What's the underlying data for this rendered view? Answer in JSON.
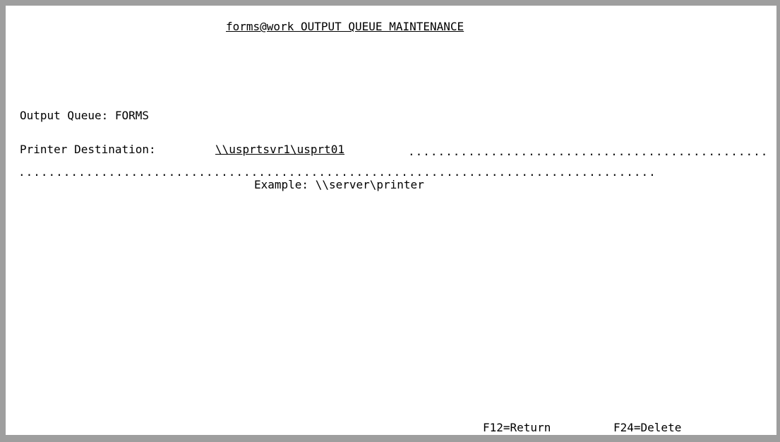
{
  "screen": {
    "title": "forms@work OUTPUT QUEUE MAINTENANCE"
  },
  "output_queue": {
    "label": "Output Queue: FORMS"
  },
  "printer_destination": {
    "label": "Printer Destination:",
    "value": "\\\\usprtsvr1\\usprt01",
    "example": "Example: \\\\server\\printer"
  },
  "function_keys": {
    "return_label": "F12=Return",
    "delete_label": "F24=Delete"
  }
}
